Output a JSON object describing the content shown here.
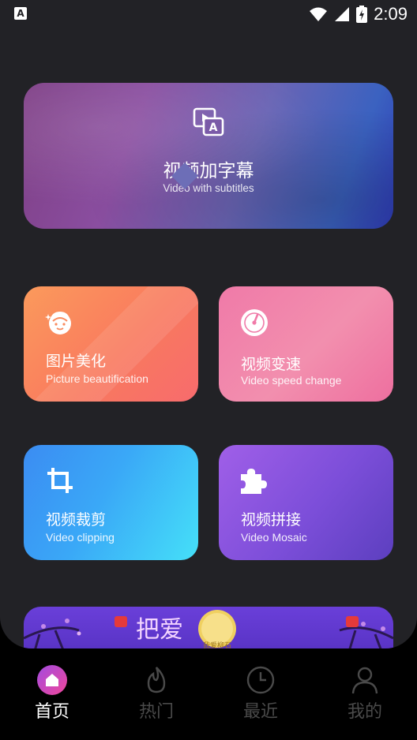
{
  "status_bar": {
    "time": "2:09",
    "left_icon": "A"
  },
  "hero": {
    "title": "视频加字幕",
    "subtitle": "Video with subtitles",
    "icon": "subtitle-icon"
  },
  "cards": [
    {
      "title": "图片美化",
      "subtitle": "Picture beautification",
      "icon": "face-icon"
    },
    {
      "title": "视频变速",
      "subtitle": "Video speed change",
      "icon": "speedometer-icon"
    },
    {
      "title": "视频裁剪",
      "subtitle": "Video clipping",
      "icon": "crop-icon"
    },
    {
      "title": "视频拼接",
      "subtitle": "Video Mosaic",
      "icon": "puzzle-icon"
    }
  ],
  "banner": {
    "text": "把爱",
    "badge": "我爱柳石"
  },
  "tabs": [
    {
      "label": "首页",
      "icon": "home-icon",
      "active": true
    },
    {
      "label": "热门",
      "icon": "flame-icon",
      "active": false
    },
    {
      "label": "最近",
      "icon": "clock-icon",
      "active": false
    },
    {
      "label": "我的",
      "icon": "person-icon",
      "active": false
    }
  ],
  "colors": {
    "background": "#222226",
    "tabbar": "#000000",
    "tab_inactive": "#4a4a4a",
    "tab_active": "#ffffff"
  }
}
